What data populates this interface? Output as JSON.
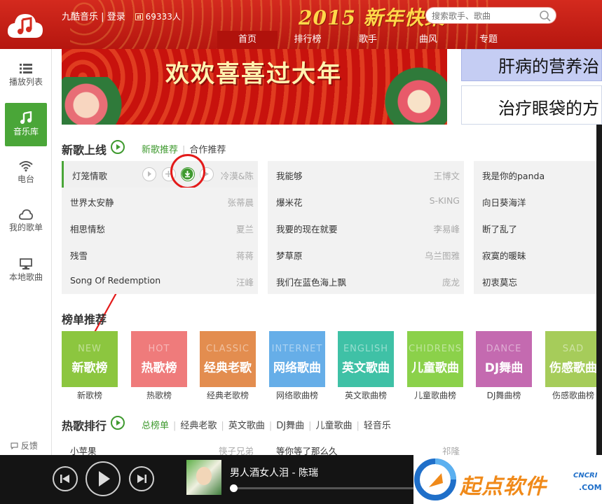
{
  "header": {
    "app_name": "九酷音乐",
    "separator": "|",
    "login": "登录",
    "online_count": "69333人",
    "festival_text": "2015 新年快樂",
    "search_placeholder": "搜索歌手、歌曲",
    "nav": [
      "首页",
      "排行榜",
      "歌手",
      "曲风",
      "专题"
    ],
    "nav_active": "首页"
  },
  "sidebar": {
    "items": [
      {
        "label": "播放列表",
        "icon": "list-icon"
      },
      {
        "label": "音乐库",
        "icon": "music-note-icon",
        "active": true
      },
      {
        "label": "电台",
        "icon": "wifi-icon"
      },
      {
        "label": "我的歌单",
        "icon": "cloud-icon"
      },
      {
        "label": "本地歌曲",
        "icon": "monitor-icon"
      }
    ],
    "feedback": "反馈"
  },
  "banner": {
    "text": "欢欢喜喜过大年"
  },
  "ads": {
    "ad1": "肝病的营养治",
    "ad2": "治疗眼袋的方"
  },
  "new_songs": {
    "title": "新歌上线",
    "tabs": [
      "新歌推荐",
      "合作推荐"
    ],
    "tab_sep": "|",
    "columns": [
      [
        {
          "name": "灯笼情歌",
          "artist": "冷漠&陈"
        },
        {
          "name": "世界太安静",
          "artist": "张蒂晨"
        },
        {
          "name": "相思情愁",
          "artist": "夏兰"
        },
        {
          "name": "残雪",
          "artist": "蒋蒋"
        },
        {
          "name": "Song Of Redemption",
          "artist": "汪峰"
        }
      ],
      [
        {
          "name": "我能够",
          "artist": "王博文"
        },
        {
          "name": "爆米花",
          "artist": "S-KING"
        },
        {
          "name": "我要的现在就要",
          "artist": "李易峰"
        },
        {
          "name": "梦草原",
          "artist": "乌兰图雅"
        },
        {
          "name": "我们在蓝色海上飘",
          "artist": "庞龙"
        }
      ],
      [
        {
          "name": "我是你的panda",
          "artist": ""
        },
        {
          "name": "向日葵海洋",
          "artist": ""
        },
        {
          "name": "断了乱了",
          "artist": ""
        },
        {
          "name": "寂寞的暖昧",
          "artist": ""
        },
        {
          "name": "初衷莫忘",
          "artist": ""
        }
      ]
    ]
  },
  "charts_section": {
    "title": "榜单推荐",
    "items": [
      {
        "en": "NEW",
        "cn": "新歌榜",
        "label": "新歌榜",
        "color": "#8cc63f"
      },
      {
        "en": "HOT",
        "cn": "热歌榜",
        "label": "热歌榜",
        "color": "#ef7b7b"
      },
      {
        "en": "CLASSIC",
        "cn": "经典老歌",
        "label": "经典老歌榜",
        "color": "#e38d4f"
      },
      {
        "en": "INTERNET",
        "cn": "网络歌曲",
        "label": "网络歌曲榜",
        "color": "#66aee8"
      },
      {
        "en": "ENGLISH",
        "cn": "英文歌曲",
        "label": "英文歌曲榜",
        "color": "#3fc1a6"
      },
      {
        "en": "CHIDRENS",
        "cn": "儿童歌曲",
        "label": "儿童歌曲榜",
        "color": "#8bd14a"
      },
      {
        "en": "DANCE",
        "cn": "DJ舞曲",
        "label": "DJ舞曲榜",
        "color": "#c46ab0"
      },
      {
        "en": "SAD",
        "cn": "伤感歌曲",
        "label": "伤感歌曲榜",
        "color": "#a6cc5a"
      }
    ]
  },
  "hot_ranking": {
    "title": "热歌排行",
    "tabs": [
      "总榜单",
      "经典老歌",
      "英文歌曲",
      "DJ舞曲",
      "儿童歌曲",
      "轻音乐"
    ],
    "tab_sep": "|",
    "rows": [
      {
        "name": "小苹果",
        "artist": "筷子兄弟"
      },
      {
        "name": "等你等了那么久",
        "artist": "祁隆"
      }
    ]
  },
  "player": {
    "now_playing": "男人酒女人泪 - 陈瑞",
    "progress": 0
  },
  "watermark": {
    "cn": "起点软件",
    "en": "CNCRI",
    "domain": ".COM"
  }
}
